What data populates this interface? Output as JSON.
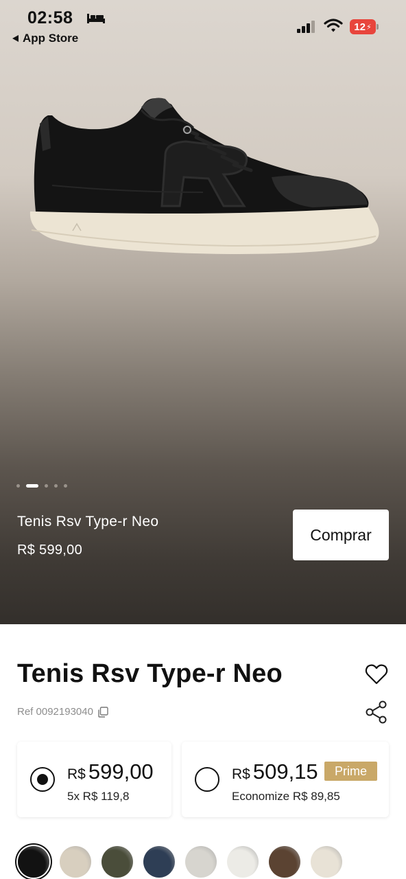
{
  "status_bar": {
    "time": "02:58",
    "back_label": "App Store",
    "battery_level": "12"
  },
  "hero": {
    "product_name": "Tenis Rsv Type-r Neo",
    "price": "R$ 599,00",
    "buy_label": "Comprar",
    "carousel_page_count": 5,
    "carousel_active_index": 1
  },
  "product": {
    "title": "Tenis Rsv Type-r Neo",
    "ref": "Ref 0092193040"
  },
  "price_options": [
    {
      "currency": "R$",
      "amount": "599,00",
      "subtext": "5x R$ 119,8",
      "selected": true
    },
    {
      "currency": "R$",
      "amount": "509,15",
      "badge": "Prime",
      "subtext": "Economize R$ 89,85",
      "selected": false
    }
  ],
  "color_swatches": [
    {
      "name": "black",
      "color": "#121212",
      "selected": true
    },
    {
      "name": "beige",
      "color": "#d8cfbf",
      "selected": false
    },
    {
      "name": "olive",
      "color": "#4a4d3a",
      "selected": false
    },
    {
      "name": "navy",
      "color": "#2e3e55",
      "selected": false
    },
    {
      "name": "light-grey",
      "color": "#d7d5cf",
      "selected": false
    },
    {
      "name": "off-white",
      "color": "#ecebe6",
      "selected": false
    },
    {
      "name": "brown",
      "color": "#5b4332",
      "selected": false
    },
    {
      "name": "cream",
      "color": "#e8e2d6",
      "selected": false
    }
  ],
  "colors": {
    "prime_badge": "#c9a868",
    "battery_low": "#e8453c"
  }
}
